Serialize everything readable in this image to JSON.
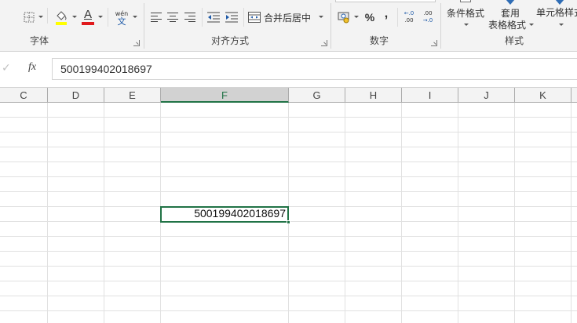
{
  "ribbon": {
    "groups": {
      "font": {
        "label": "字体"
      },
      "alignment": {
        "label": "对齐方式"
      },
      "number": {
        "label": "数字"
      },
      "styles": {
        "label": "样式"
      }
    },
    "font_color_glyph": "A",
    "phonetic_glyph_top": "wén",
    "phonetic_glyph_bottom": "文",
    "merge_center_label": "合并后居中",
    "percent_glyph": "%",
    "comma_glyph": ",",
    "increase_decimal_top": "←.0",
    "increase_decimal_bottom": ".00",
    "decrease_decimal_top": ".00",
    "decrease_decimal_bottom": "→.0",
    "conditional_format_label": "条件格式",
    "format_as_table_line1": "套用",
    "format_as_table_line2": "表格格式",
    "cell_styles_label": "单元格样式",
    "colors": {
      "highlight": "#ffff00",
      "font_color": "#e0191c",
      "accent": "#217346"
    }
  },
  "formula_bar": {
    "cancel_glyph": "✓",
    "fx_label": "fx",
    "value": "500199402018697"
  },
  "columns": [
    "C",
    "D",
    "E",
    "F",
    "G",
    "H",
    "I",
    "J",
    "K"
  ],
  "selected_column": "F",
  "active_cell": {
    "value": "500199402018697"
  }
}
